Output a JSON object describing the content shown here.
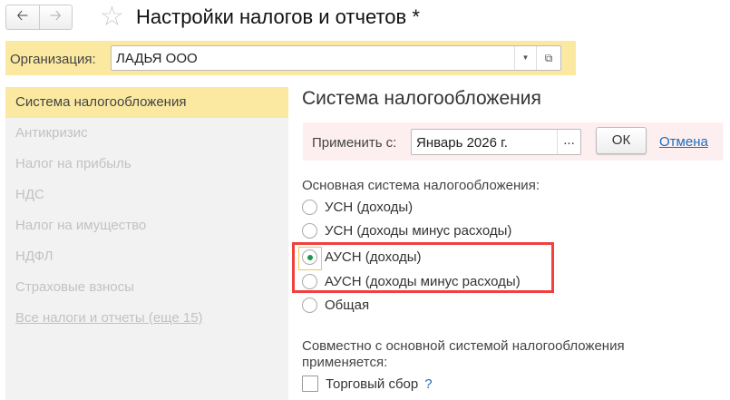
{
  "header": {
    "title": "Настройки налогов и отчетов *",
    "back_icon": "arrow-left-icon",
    "forward_icon": "arrow-right-icon",
    "favorite_icon": "star-icon"
  },
  "organization": {
    "label": "Организация:",
    "value": "ЛАДЬЯ ООО"
  },
  "sidebar": {
    "items": [
      {
        "label": "Система налогообложения",
        "selected": true
      },
      {
        "label": "Антикризис"
      },
      {
        "label": "Налог на прибыль"
      },
      {
        "label": "НДС"
      },
      {
        "label": "Налог на имущество"
      },
      {
        "label": "НДФЛ"
      },
      {
        "label": "Страховые взносы"
      },
      {
        "label": "Все налоги и отчеты (еще 15)"
      }
    ]
  },
  "main": {
    "title": "Система налогообложения",
    "apply": {
      "label": "Применить с:",
      "value": "Январь 2026 г.",
      "select_label": "...",
      "ok_label": "ОК",
      "cancel_label": "Отмена"
    },
    "tax_system_label": "Основная система налогообложения:",
    "options": [
      "УСН (доходы)",
      "УСН (доходы минус расходы)",
      "АУСН (доходы)",
      "АУСН (доходы минус расходы)",
      "Общая"
    ],
    "selected_option": "АУСН (доходы)",
    "additional_label_1": "Совместно с основной системой налогообложения",
    "additional_label_2": "применяется:",
    "trade_fee_label": "Торговый сбор",
    "help_label": "?"
  },
  "colors": {
    "highlight": "#fbe9a1",
    "accent_link": "#1a6ebf",
    "annotation": "#f04040"
  }
}
